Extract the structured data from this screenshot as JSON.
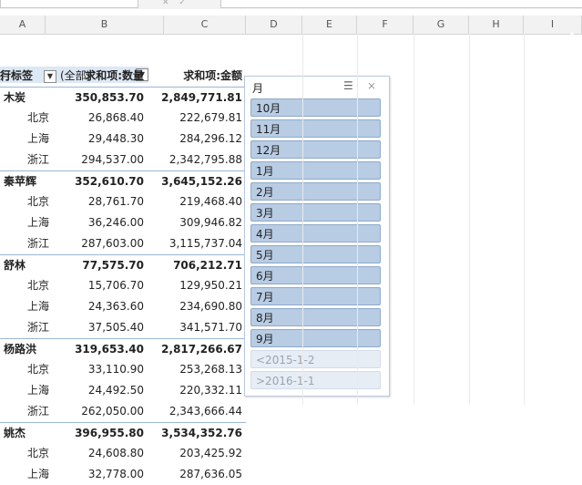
{
  "columns": [
    "A",
    "B",
    "C",
    "D",
    "E",
    "F",
    "G",
    "H",
    "I"
  ],
  "filter": {
    "label": "月",
    "value": "(全部)"
  },
  "header": {
    "row_label": "行标签",
    "sum_qty": "求和项:数量",
    "sum_amt": "求和项:金额"
  },
  "rows": [
    {
      "label": "木炭",
      "qty": "350,853.70",
      "amt": "2,849,771.81",
      "group": true
    },
    {
      "label": "北京",
      "qty": "26,868.40",
      "amt": "222,679.81",
      "group": false
    },
    {
      "label": "上海",
      "qty": "29,448.30",
      "amt": "284,296.12",
      "group": false
    },
    {
      "label": "浙江",
      "qty": "294,537.00",
      "amt": "2,342,795.88",
      "group": false
    },
    {
      "label": "秦苹辉",
      "qty": "352,610.70",
      "amt": "3,645,152.26",
      "group": true
    },
    {
      "label": "北京",
      "qty": "28,761.70",
      "amt": "219,468.40",
      "group": false
    },
    {
      "label": "上海",
      "qty": "36,246.00",
      "amt": "309,946.82",
      "group": false
    },
    {
      "label": "浙江",
      "qty": "287,603.00",
      "amt": "3,115,737.04",
      "group": false
    },
    {
      "label": "舒林",
      "qty": "77,575.70",
      "amt": "706,212.71",
      "group": true
    },
    {
      "label": "北京",
      "qty": "15,706.70",
      "amt": "129,950.21",
      "group": false
    },
    {
      "label": "上海",
      "qty": "24,363.60",
      "amt": "234,690.80",
      "group": false
    },
    {
      "label": "浙江",
      "qty": "37,505.40",
      "amt": "341,571.70",
      "group": false
    },
    {
      "label": "杨路洪",
      "qty": "319,653.40",
      "amt": "2,817,266.67",
      "group": true
    },
    {
      "label": "北京",
      "qty": "33,110.90",
      "amt": "253,268.13",
      "group": false
    },
    {
      "label": "上海",
      "qty": "24,492.50",
      "amt": "220,332.11",
      "group": false
    },
    {
      "label": "浙江",
      "qty": "262,050.00",
      "amt": "2,343,666.44",
      "group": false
    },
    {
      "label": "姚杰",
      "qty": "396,955.80",
      "amt": "3,534,352.76",
      "group": true
    },
    {
      "label": "北京",
      "qty": "24,608.80",
      "amt": "203,425.92",
      "group": false
    },
    {
      "label": "上海",
      "qty": "32,778.00",
      "amt": "287,636.05",
      "group": false
    }
  ],
  "slicer": {
    "title": "月",
    "items": [
      {
        "label": "10月",
        "state": "selected"
      },
      {
        "label": "11月",
        "state": "selected"
      },
      {
        "label": "12月",
        "state": "selected"
      },
      {
        "label": "1月",
        "state": "selected"
      },
      {
        "label": "2月",
        "state": "selected"
      },
      {
        "label": "3月",
        "state": "selected"
      },
      {
        "label": "4月",
        "state": "selected"
      },
      {
        "label": "5月",
        "state": "selected"
      },
      {
        "label": "6月",
        "state": "selected"
      },
      {
        "label": "7月",
        "state": "selected"
      },
      {
        "label": "8月",
        "state": "selected"
      },
      {
        "label": "9月",
        "state": "selected"
      },
      {
        "label": "<2015-1-2",
        "state": "nodata"
      },
      {
        "label": ">2016-1-1",
        "state": "nodata"
      }
    ]
  },
  "icons": {
    "dropdown": "dropdown-arrow-icon",
    "multiselect": "multi-select-icon",
    "clear_filter": "clear-filter-icon"
  },
  "colors": {
    "slicer_selected": "#b8cce4",
    "slicer_nodata": "#e6edf5",
    "filter_bg": "#dde8f5",
    "group_border": "#9bb6d6"
  }
}
